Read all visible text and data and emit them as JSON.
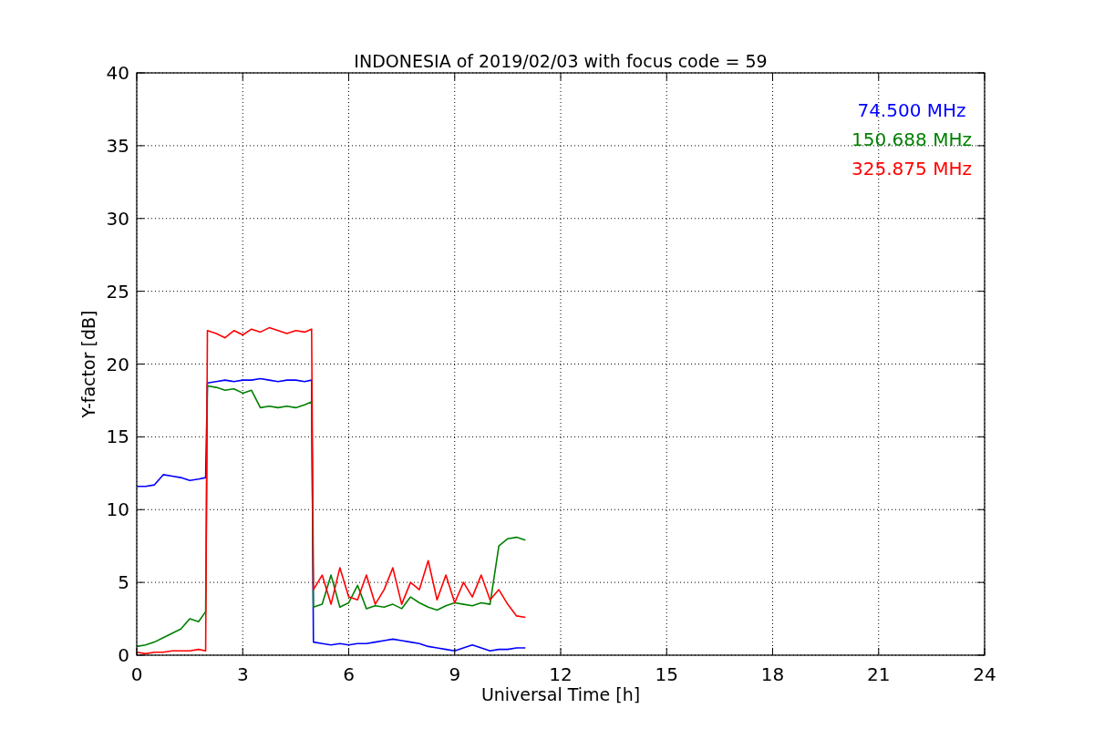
{
  "chart_data": {
    "type": "line",
    "title": "INDONESIA of 2019/02/03 with focus code = 59",
    "xlabel": "Universal Time [h]",
    "ylabel": "Y-factor [dB]",
    "x": [
      0,
      0.25,
      0.5,
      0.75,
      1,
      1.25,
      1.5,
      1.75,
      1.95,
      2,
      2.25,
      2.5,
      2.75,
      3,
      3.25,
      3.5,
      3.75,
      4,
      4.25,
      4.5,
      4.75,
      4.95,
      5,
      5.25,
      5.5,
      5.75,
      6,
      6.25,
      6.5,
      6.75,
      7,
      7.25,
      7.5,
      7.75,
      8,
      8.25,
      8.5,
      8.75,
      9,
      9.25,
      9.5,
      9.75,
      10,
      10.25,
      10.5,
      10.75,
      11
    ],
    "series": [
      {
        "name": "74.500 MHz",
        "color": "#0000ff",
        "values": [
          11.6,
          11.6,
          11.7,
          12.4,
          12.3,
          12.2,
          12.0,
          12.1,
          12.2,
          18.7,
          18.8,
          18.9,
          18.8,
          18.9,
          18.9,
          19.0,
          18.9,
          18.8,
          18.9,
          18.9,
          18.8,
          18.9,
          0.9,
          0.8,
          0.7,
          0.8,
          0.7,
          0.8,
          0.8,
          0.9,
          1.0,
          1.1,
          1.0,
          0.9,
          0.8,
          0.6,
          0.5,
          0.4,
          0.3,
          0.5,
          0.7,
          0.5,
          0.3,
          0.4,
          0.4,
          0.5,
          0.5
        ]
      },
      {
        "name": "150.688 MHz",
        "color": "#008000",
        "values": [
          0.6,
          0.7,
          0.9,
          1.2,
          1.5,
          1.8,
          2.5,
          2.3,
          3.0,
          18.5,
          18.4,
          18.2,
          18.3,
          18.0,
          18.2,
          17.0,
          17.1,
          17.0,
          17.1,
          17.0,
          17.2,
          17.4,
          3.3,
          3.5,
          5.5,
          3.3,
          3.6,
          4.8,
          3.2,
          3.4,
          3.3,
          3.5,
          3.2,
          4.0,
          3.6,
          3.3,
          3.1,
          3.4,
          3.6,
          3.5,
          3.4,
          3.6,
          3.5,
          7.5,
          8.0,
          8.1,
          7.9
        ]
      },
      {
        "name": "325.875 MHz",
        "color": "#ff0000",
        "values": [
          0.2,
          0.1,
          0.2,
          0.2,
          0.3,
          0.3,
          0.3,
          0.4,
          0.3,
          22.3,
          22.1,
          21.8,
          22.3,
          22.0,
          22.4,
          22.2,
          22.5,
          22.3,
          22.1,
          22.3,
          22.2,
          22.4,
          4.5,
          5.5,
          3.5,
          6.0,
          4.0,
          3.8,
          5.5,
          3.5,
          4.5,
          6.0,
          3.5,
          5.0,
          4.5,
          6.5,
          3.8,
          5.5,
          3.6,
          5.0,
          4.0,
          5.5,
          3.8,
          4.5,
          3.5,
          2.7,
          2.6
        ]
      }
    ],
    "grid": true,
    "xlim": [
      0,
      24
    ],
    "ylim": [
      0,
      40
    ],
    "xticks": [
      0,
      3,
      6,
      9,
      12,
      15,
      18,
      21,
      24
    ],
    "yticks": [
      0,
      5,
      10,
      15,
      20,
      25,
      30,
      35,
      40
    ]
  }
}
